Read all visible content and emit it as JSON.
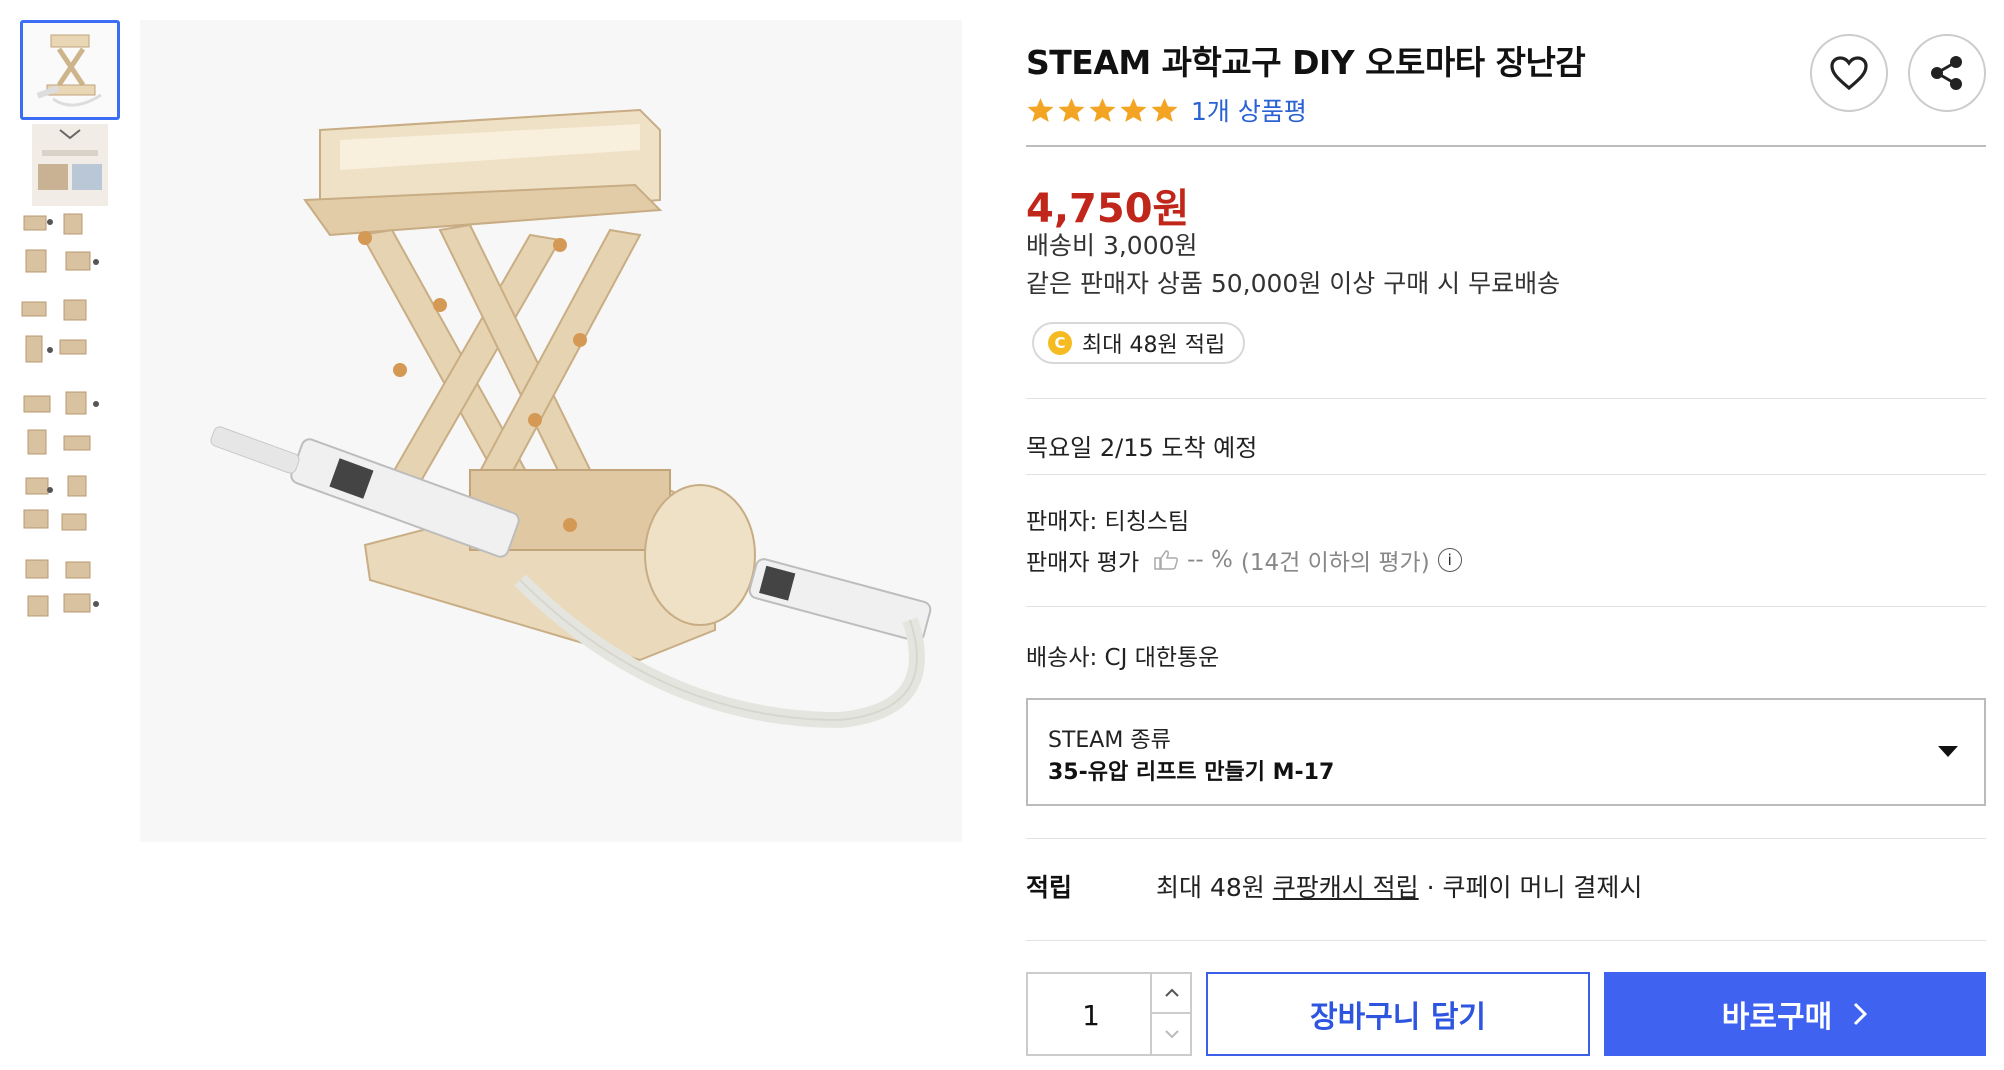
{
  "product": {
    "title": "STEAM 과학교구 DIY 오토마타 장난감",
    "rating_stars": 5,
    "review_link": "1개 상품평"
  },
  "actions": {
    "wishlist_icon": "heart-icon",
    "share_icon": "share-icon"
  },
  "pricing": {
    "price": "4,750원",
    "shipping_fee": "배송비 3,000원",
    "free_shipping_note": "같은 판매자 상품 50,000원 이상 구매 시 무료배송",
    "cash_badge_letter": "C",
    "cash_badge": "최대 48원 적립"
  },
  "delivery": {
    "arrival": "목요일 2/15 도착 예정"
  },
  "seller": {
    "label": "판매자: 티칭스팀",
    "rating_label": "판매자 평가",
    "rating_value": "-- %",
    "rating_note": "(14건 이하의 평가)",
    "info_icon_letter": "i"
  },
  "shipping": {
    "carrier": "배송사: CJ 대한통운"
  },
  "option": {
    "label": "STEAM 종류",
    "value": "35-유압 리프트 만들기 M-17"
  },
  "reward": {
    "label": "적립",
    "prefix": "최대 48원",
    "link": "쿠팡캐시 적립",
    "suffix": "· 쿠페이 머니 결제시"
  },
  "purchase": {
    "quantity": "1",
    "cart_label": "장바구니 담기",
    "buy_label": "바로구매"
  },
  "colors": {
    "price": "#c0261a",
    "accent": "#3f63f0",
    "link": "#2a62d4",
    "star": "#f4a423"
  }
}
